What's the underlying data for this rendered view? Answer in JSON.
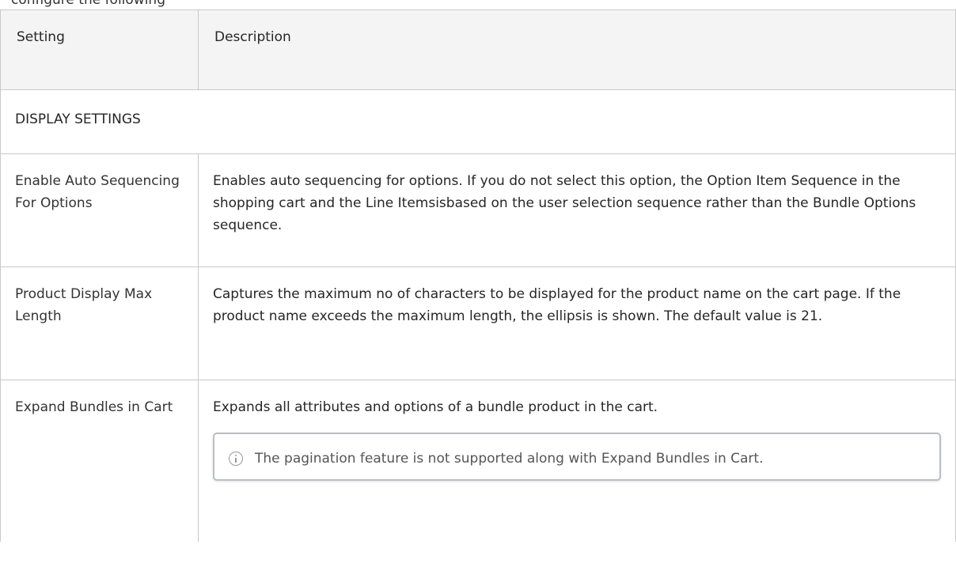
{
  "caption": "configure the following",
  "table": {
    "headers": {
      "setting": "Setting",
      "description": "Description"
    },
    "section_title": "DISPLAY SETTINGS",
    "rows": [
      {
        "setting": "Enable Auto Sequencing For Options",
        "description": "Enables auto sequencing for options. If you do not select this option, the Option Item Sequence in the shopping cart and the Line Itemsisbased on the user selection sequence rather than the Bundle Options sequence."
      },
      {
        "setting": "Product Display Max Length",
        "description": "Captures the maximum no of characters to be displayed for the product name on the cart page. If the product name exceeds the maximum length, the ellipsis is shown. The default value is 21."
      },
      {
        "setting": "Expand Bundles in Cart",
        "description": "Expands all attributes and options of a bundle product in the cart.",
        "note": {
          "icon": "info-icon",
          "text": "The pagination feature is not supported along with Expand Bundles in Cart."
        }
      }
    ]
  }
}
